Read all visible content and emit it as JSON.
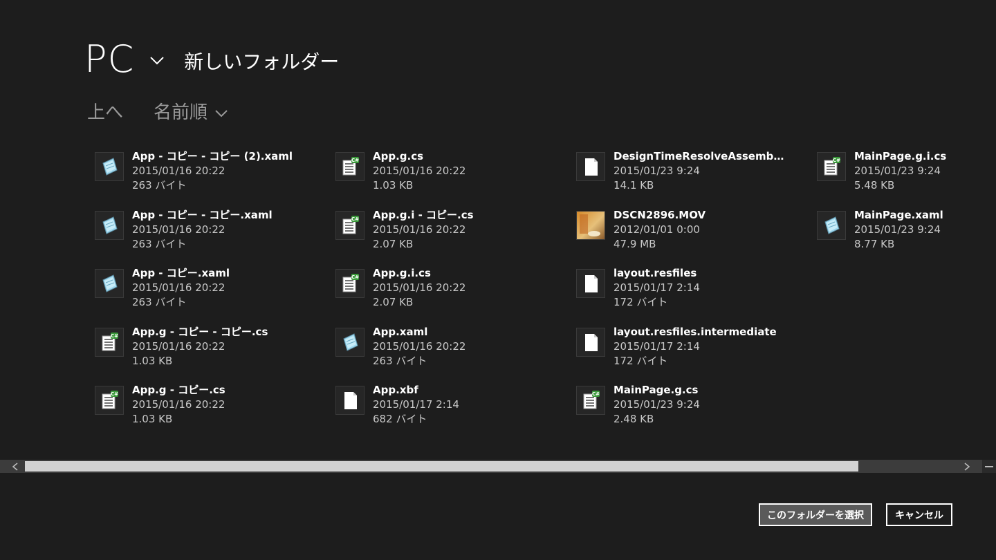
{
  "header": {
    "location": "PC",
    "folder_name": "新しいフォルダー"
  },
  "toolbar": {
    "up_label": "上へ",
    "sort_label": "名前順"
  },
  "files": [
    {
      "name": "App - コピー - コピー (2).xaml",
      "date": "2015/01/16 20:22",
      "size": "263 バイト",
      "icon": "xaml-file-icon"
    },
    {
      "name": "App - コピー - コピー.xaml",
      "date": "2015/01/16 20:22",
      "size": "263 バイト",
      "icon": "xaml-file-icon"
    },
    {
      "name": "App - コピー.xaml",
      "date": "2015/01/16 20:22",
      "size": "263 バイト",
      "icon": "xaml-file-icon"
    },
    {
      "name": "App.g - コピー - コピー.cs",
      "date": "2015/01/16 20:22",
      "size": "1.03 KB",
      "icon": "csharp-file-icon"
    },
    {
      "name": "App.g - コピー.cs",
      "date": "2015/01/16 20:22",
      "size": "1.03 KB",
      "icon": "csharp-file-icon"
    },
    {
      "name": "App.g.cs",
      "date": "2015/01/16 20:22",
      "size": "1.03 KB",
      "icon": "csharp-file-icon"
    },
    {
      "name": "App.g.i - コピー.cs",
      "date": "2015/01/16 20:22",
      "size": "2.07 KB",
      "icon": "csharp-file-icon"
    },
    {
      "name": "App.g.i.cs",
      "date": "2015/01/16 20:22",
      "size": "2.07 KB",
      "icon": "csharp-file-icon"
    },
    {
      "name": "App.xaml",
      "date": "2015/01/16 20:22",
      "size": "263 バイト",
      "icon": "xaml-file-icon"
    },
    {
      "name": "App.xbf",
      "date": "2015/01/17 2:14",
      "size": "682 バイト",
      "icon": "generic-file-icon"
    },
    {
      "name": "DesignTimeResolveAssemblyR…",
      "date": "2015/01/23 9:24",
      "size": "14.1 KB",
      "icon": "generic-file-icon"
    },
    {
      "name": "DSCN2896.MOV",
      "date": "2012/01/01 0:00",
      "size": "47.9 MB",
      "icon": "video-thumbnail-icon"
    },
    {
      "name": "layout.resfiles",
      "date": "2015/01/17 2:14",
      "size": "172 バイト",
      "icon": "generic-file-icon"
    },
    {
      "name": "layout.resfiles.intermediate",
      "date": "2015/01/17 2:14",
      "size": "172 バイト",
      "icon": "generic-file-icon"
    },
    {
      "name": "MainPage.g.cs",
      "date": "2015/01/23 9:24",
      "size": "2.48 KB",
      "icon": "csharp-file-icon"
    },
    {
      "name": "MainPage.g.i.cs",
      "date": "2015/01/23 9:24",
      "size": "5.48 KB",
      "icon": "csharp-file-icon"
    },
    {
      "name": "MainPage.xaml",
      "date": "2015/01/23 9:24",
      "size": "8.77 KB",
      "icon": "xaml-file-icon"
    }
  ],
  "buttons": {
    "select_label": "このフォルダーを選択",
    "cancel_label": "キャンセル"
  }
}
